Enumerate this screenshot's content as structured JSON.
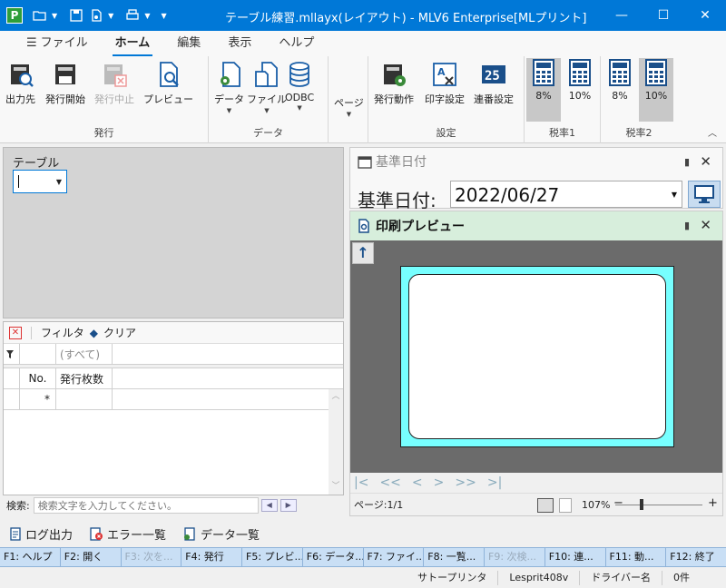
{
  "window": {
    "title": "テーブル練習.mllayx(レイアウト) - MLV6 Enterprise[MLプリント]",
    "app_icon": "P"
  },
  "ribbon_tabs": [
    {
      "label": "ファイル"
    },
    {
      "label": "ホーム"
    },
    {
      "label": "編集"
    },
    {
      "label": "表示"
    },
    {
      "label": "ヘルプ"
    }
  ],
  "ribbon": {
    "groups": {
      "issue": {
        "label": "発行",
        "buttons": [
          "出力先",
          "発行開始",
          "発行中止",
          "プレビュー"
        ]
      },
      "data": {
        "label": "データ",
        "buttons": [
          "データ",
          "ファイル",
          "ODBC"
        ]
      },
      "page": {
        "buttons": [
          "ページ"
        ]
      },
      "settings": {
        "label": "設定",
        "buttons": [
          "発行動作",
          "印字設定",
          "連番設定"
        ]
      },
      "tax1": {
        "label": "税率1",
        "buttons": [
          "8%",
          "10%"
        ]
      },
      "tax2": {
        "label": "税率2",
        "buttons": [
          "8%",
          "10%"
        ]
      }
    }
  },
  "table_panel": {
    "label": "テーブル"
  },
  "filter_bar": {
    "filter_label": "フィルタ",
    "clear_label": "クリア"
  },
  "grid": {
    "filter_placeholder": "(すべて)",
    "columns": [
      "No.",
      "発行枚数"
    ],
    "new_row_marker": "*"
  },
  "search": {
    "label": "検索:",
    "placeholder": "検索文字を入力してください。"
  },
  "base_date": {
    "panel_title": "基準日付",
    "label": "基準日付:",
    "value": "2022/06/27"
  },
  "preview": {
    "title": "印刷プレビュー",
    "page_info": "ページ:1/1",
    "zoom": "107%"
  },
  "bottom_tools": [
    {
      "label": "ログ出力"
    },
    {
      "label": "エラー一覧"
    },
    {
      "label": "データ一覧"
    }
  ],
  "fkeys": [
    {
      "label": "F1: ヘルプ"
    },
    {
      "label": "F2: 開く"
    },
    {
      "label": "F3: 次を..."
    },
    {
      "label": "F4: 発行"
    },
    {
      "label": "F5: プレビ..."
    },
    {
      "label": "F6: データ..."
    },
    {
      "label": "F7: ファイ..."
    },
    {
      "label": "F8: 一覧..."
    },
    {
      "label": "F9: 次検..."
    },
    {
      "label": "F10: 連..."
    },
    {
      "label": "F11: 動..."
    },
    {
      "label": "F12: 終了"
    }
  ],
  "statusbar": {
    "printer": "サトープリンタ",
    "model": "Lesprit408v",
    "driver": "ドライバー名",
    "count": "0件"
  },
  "colors": {
    "titlebar": "#0078d7",
    "preview_header": "#d7eedc",
    "page_border": "#77ffff",
    "fkey_bar": "#c9dff5"
  }
}
